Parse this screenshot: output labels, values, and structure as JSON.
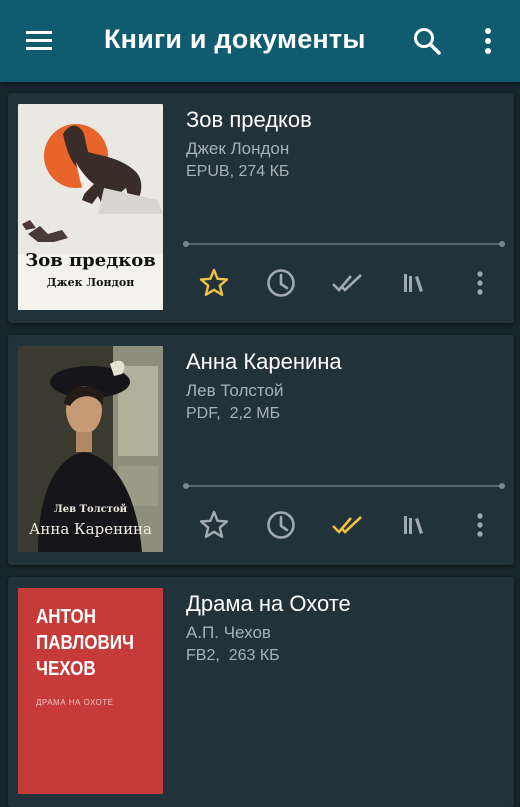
{
  "app": {
    "title": "Книги и документы",
    "icons": {
      "menu": "menu-icon",
      "search": "search-icon",
      "more": "more-vert-icon"
    },
    "colors": {
      "appbar": "#0f5b6f",
      "background": "#17252c",
      "card": "#22323a",
      "accent": "#f0c040"
    }
  },
  "books": [
    {
      "title": "Зов предков",
      "author": "Джек Лондон",
      "format": "EPUB",
      "size": "274 КБ",
      "cover_title": "Зов предков",
      "cover_author": "Джек Лондон",
      "favorite": true,
      "finished": false
    },
    {
      "title": "Анна Каренина",
      "author": "Лев Толстой",
      "format": "PDF",
      "size": "2,2 МБ",
      "cover_title": "Анна Каренина",
      "cover_author": "Лев Толстой",
      "favorite": false,
      "finished": true
    },
    {
      "title": "Драма на Охоте",
      "author": "А.П. Чехов",
      "format": "FB2",
      "size": "263 КБ",
      "cover_line1": "АНТОН",
      "cover_line2": "ПАВЛОВИЧ",
      "cover_line3": "ЧЕХОВ",
      "cover_subtitle": "ДРАМА НА ОХОТЕ"
    }
  ]
}
